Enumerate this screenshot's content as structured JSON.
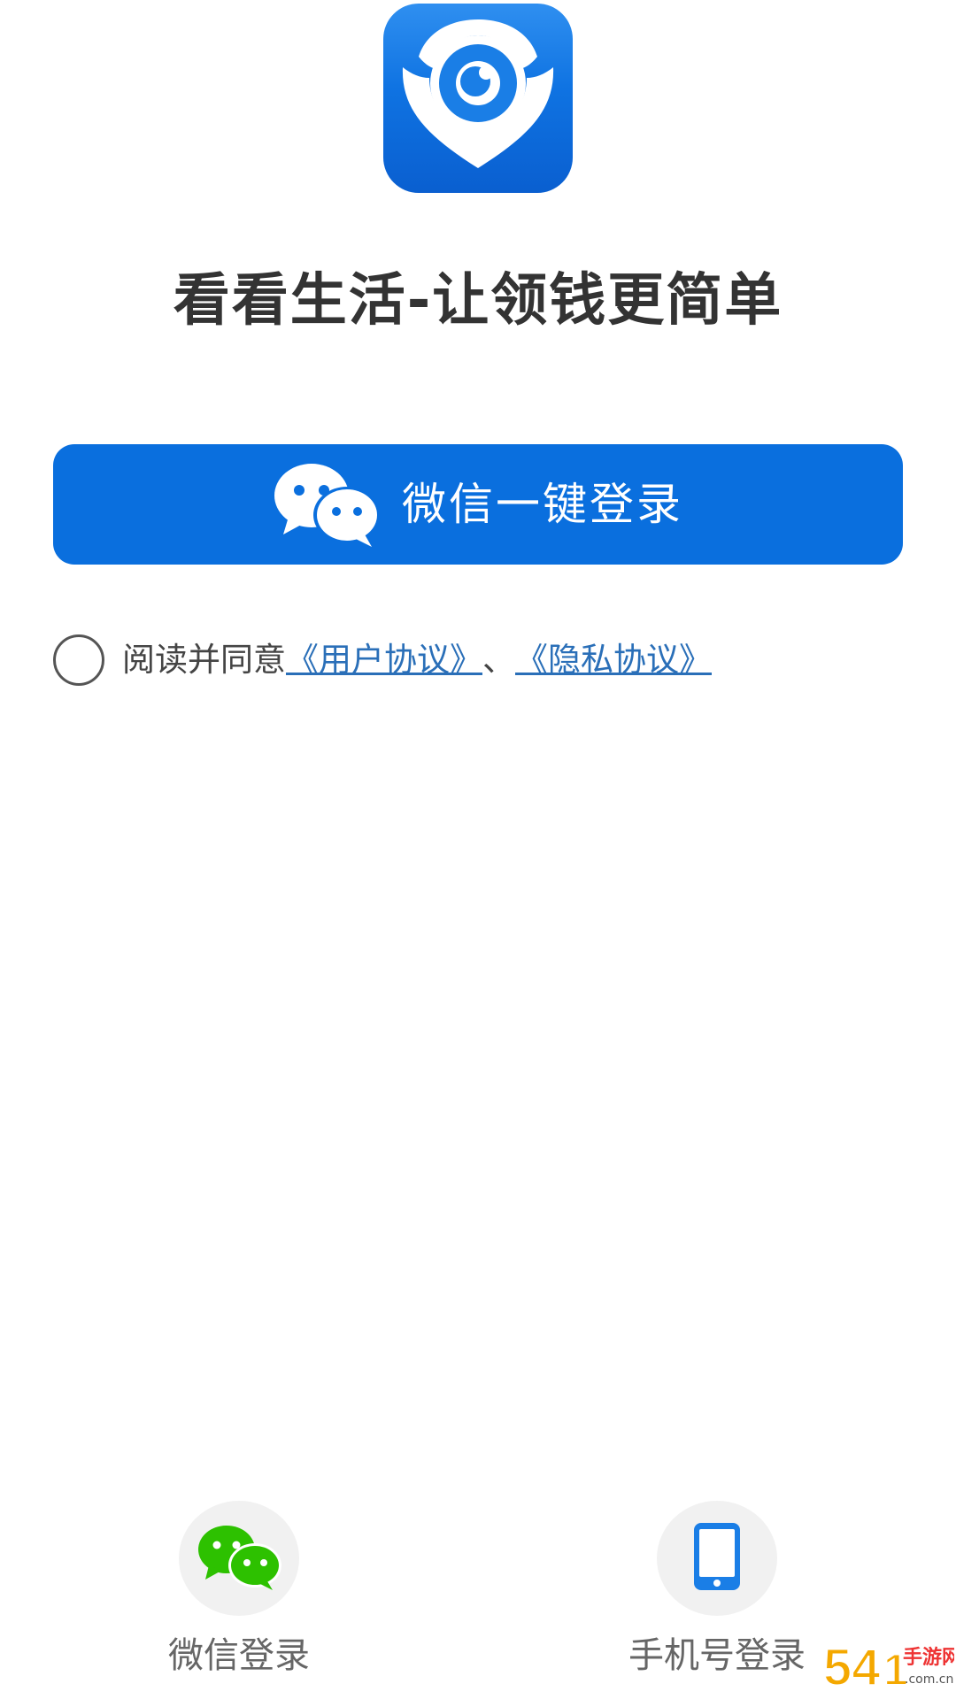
{
  "app": {
    "icon": "eye-pin-logo-icon",
    "slogan": "看看生活-让领钱更简单"
  },
  "login": {
    "wechat_button_label": "微信一键登录",
    "wechat_button_icon": "wechat-icon"
  },
  "agreement": {
    "prefix": "阅读并同意",
    "user_agreement": "《用户协议》",
    "separator": "、",
    "privacy_agreement": "《隐私协议》"
  },
  "alternatives": [
    {
      "label": "微信登录",
      "icon": "wechat-icon"
    },
    {
      "label": "手机号登录",
      "icon": "phone-icon"
    }
  ],
  "colors": {
    "primary_blue": "#0a6fde",
    "wechat_green": "#2dc100",
    "link_blue": "#2a6fb8",
    "text_dark": "#333333",
    "text_gray": "#666666"
  },
  "watermark": "54 手游网 .com.cn"
}
